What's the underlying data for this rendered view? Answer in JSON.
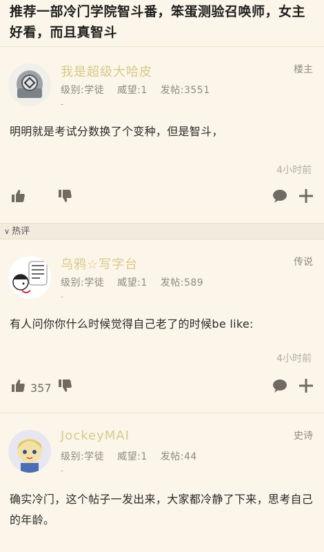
{
  "thread": {
    "title": "推荐一部冷门学院智斗番，笨蛋测验召唤师，女主好看，而且真智斗"
  },
  "section": {
    "hot_label": "热评"
  },
  "posts": [
    {
      "username": "我是超级大哈皮",
      "level": "级别:学徒",
      "prestige": "威望:1",
      "post_count": "发帖:3551",
      "dash": "-",
      "floor": "楼主",
      "body": "明明就是考试分数换了个变种，但是智斗，",
      "time": "4小时前",
      "like_count": ""
    },
    {
      "username": "乌鸦☆写字台",
      "level": "级别:学徒",
      "prestige": "威望:1",
      "post_count": "发帖:589",
      "dash": "-",
      "floor": "传说",
      "body": "有人问你你什么时候觉得自己老了的时候be like:",
      "time": "4小时前",
      "like_count": "357"
    },
    {
      "username": "JockeyMAI",
      "level": "级别:学徒",
      "prestige": "威望:1",
      "post_count": "发帖:44",
      "dash": "-",
      "floor": "史诗",
      "body": "确实冷门，这个帖子一发出来，大家都冷静了下来，思考自己的年龄。",
      "time": "",
      "like_count": ""
    }
  ],
  "icons": {
    "like": "thumbs-up-icon",
    "dislike": "thumbs-down-icon",
    "comment": "comment-bubble-icon",
    "more": "plus-icon",
    "device": "apple-icon"
  }
}
